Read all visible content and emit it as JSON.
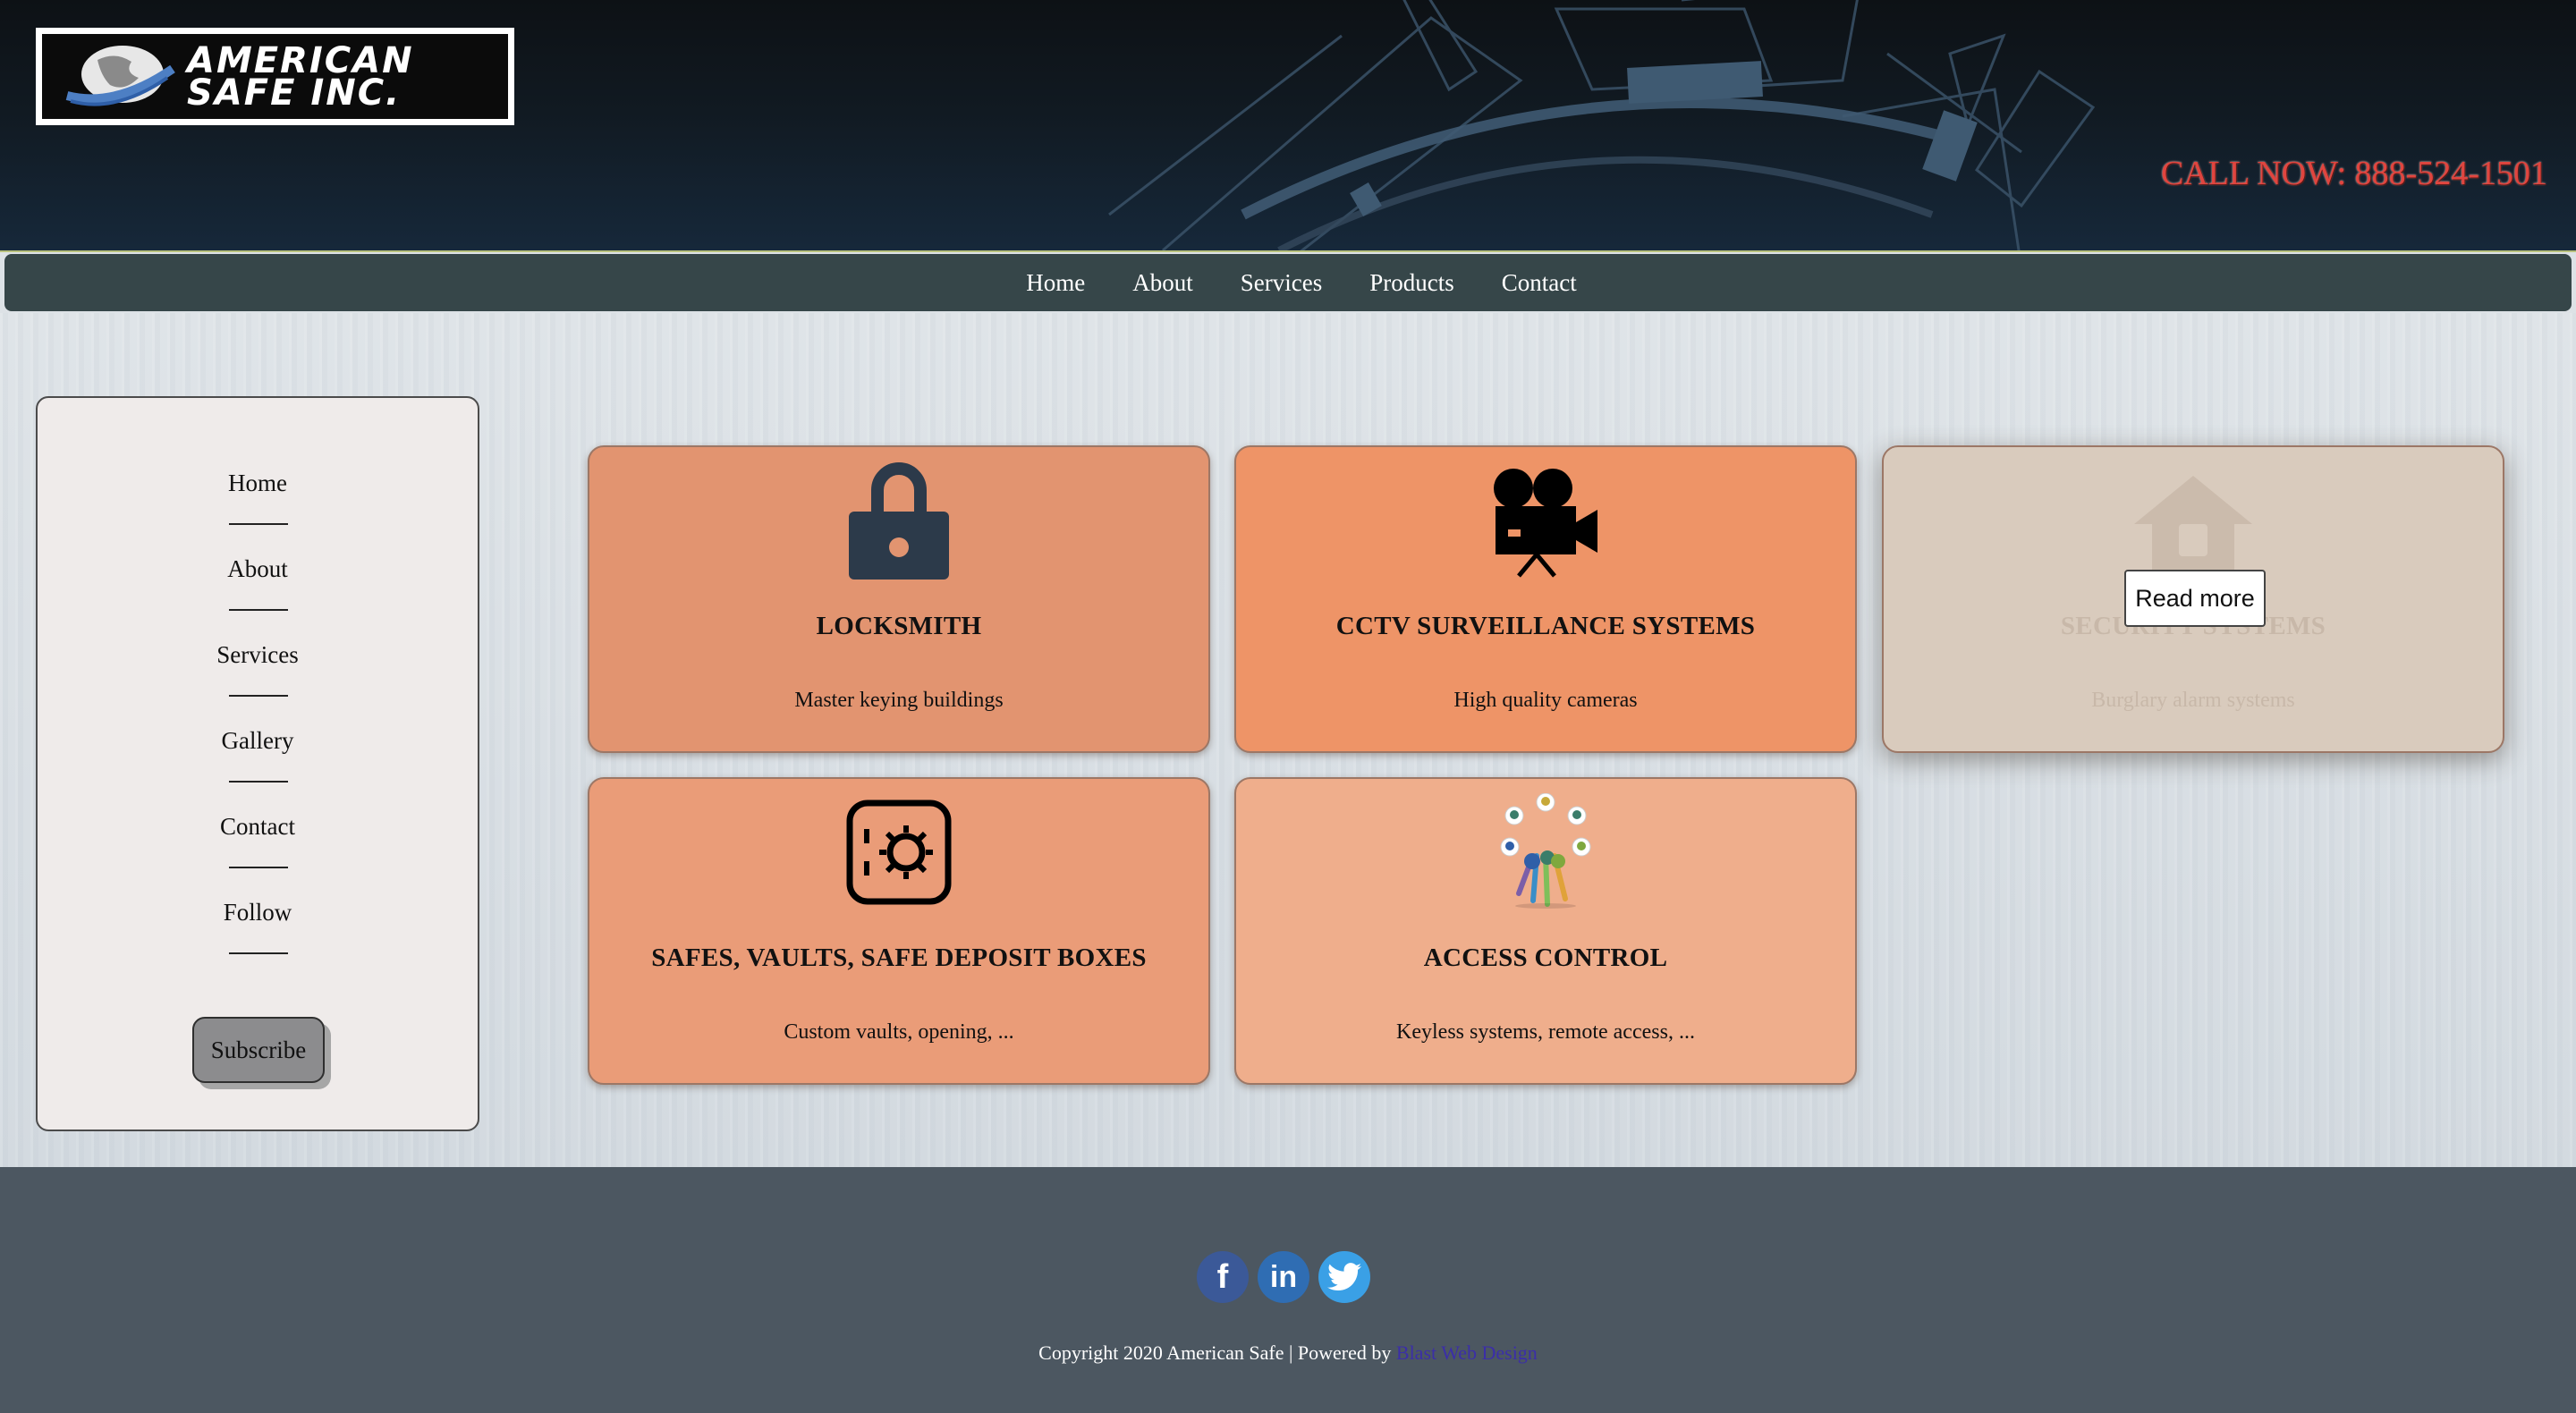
{
  "brand": {
    "logo_text": "AMERICAN\nSAFE INC.",
    "call_now": "CALL NOW: 888-524-1501"
  },
  "nav": [
    "Home",
    "About",
    "Services",
    "Products",
    "Contact"
  ],
  "sidebar": {
    "items": [
      "Home",
      "About",
      "Services",
      "Gallery",
      "Contact",
      "Follow"
    ],
    "subscribe_label": "Subscribe"
  },
  "cards": [
    {
      "title": "LOCKSMITH",
      "subtitle": "Master keying buildings",
      "icon": "padlock-icon",
      "color": "#e29470"
    },
    {
      "title": "CCTV SURVEILLANCE SYSTEMS",
      "subtitle": "High quality cameras",
      "icon": "video-camera-icon",
      "color": "#ee9467"
    },
    {
      "title": "SECURITY SYSTEMS",
      "subtitle": "Burglary alarm systems",
      "icon": "house-lock-icon",
      "color": "#d9cbbd",
      "overlay_button": "Read more"
    },
    {
      "title": "SAFES, VAULTS, SAFE DEPOSIT BOXES",
      "subtitle": "Custom vaults, opening, ...",
      "icon": "safe-icon",
      "color": "#ea9c78"
    },
    {
      "title": "ACCESS CONTROL",
      "subtitle": "Keyless systems, remote access, ...",
      "icon": "keys-people-icon",
      "color": "#efae8c"
    }
  ],
  "footer": {
    "social": [
      {
        "name": "facebook-icon",
        "glyph": "f",
        "color": "#3b5998"
      },
      {
        "name": "linkedin-icon",
        "glyph": "in",
        "color": "#2f6db3"
      },
      {
        "name": "twitter-icon",
        "glyph": "t",
        "color": "#3aa0e6"
      }
    ],
    "copyright_text": "Copyright 2020 American Safe | Powered by ",
    "powered_by_link": "Blast Web Design"
  },
  "colors": {
    "header_bg": "#0f141a",
    "nav_bg": "#364649",
    "call_now": "#e0453f",
    "footer_bg": "#4c5761",
    "icon_dark": "#2c3a4a"
  }
}
